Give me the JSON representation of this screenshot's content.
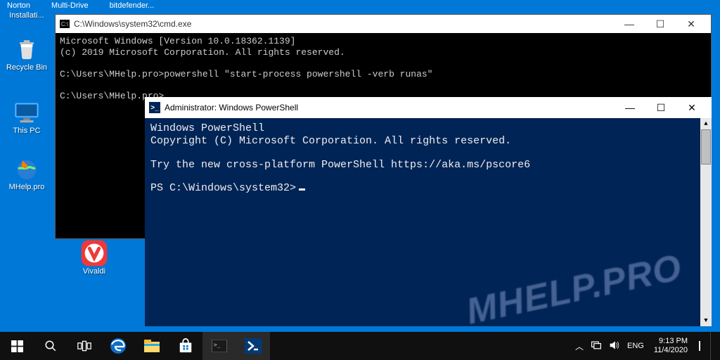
{
  "top_labels": {
    "a": "Norton",
    "b": "Multi-Drive",
    "c": "bitdefender..."
  },
  "desktop": {
    "installati": "Installati...",
    "recycle": "Recycle Bin",
    "thispc": "This PC",
    "mhelp": "MHelp.pro",
    "vivaldi": "Vivaldi"
  },
  "cmd": {
    "title": "C:\\Windows\\system32\\cmd.exe",
    "l1": "Microsoft Windows [Version 10.0.18362.1139]",
    "l2": "(c) 2019 Microsoft Corporation. All rights reserved.",
    "l3": "C:\\Users\\MHelp.pro>powershell \"start-process powershell -verb runas\"",
    "l4": "C:\\Users\\MHelp.pro>"
  },
  "ps": {
    "title": "Administrator: Windows PowerShell",
    "l1": "Windows PowerShell",
    "l2": "Copyright (C) Microsoft Corporation. All rights reserved.",
    "l3": "Try the new cross-platform PowerShell https://aka.ms/pscore6",
    "prompt": "PS C:\\Windows\\system32>"
  },
  "watermark": "MHELP.PRO",
  "tray": {
    "lang": "ENG",
    "time": "9:13 PM",
    "date": "11/4/2020"
  }
}
